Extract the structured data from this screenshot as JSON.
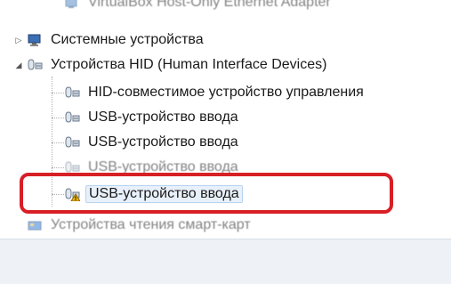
{
  "tree": {
    "items": [
      {
        "label": "VirtualBox Host-Only Ethernet Adapter",
        "icon": "network-adapter-icon",
        "state": "child"
      },
      {
        "label": "Системные устройства",
        "icon": "system-devices-icon",
        "state": "collapsed"
      },
      {
        "label": "Устройства HID (Human Interface Devices)",
        "icon": "hid-device-icon",
        "state": "expanded"
      },
      {
        "label": "HID-совместимое устройство управления",
        "icon": "hid-device-icon",
        "state": "child"
      },
      {
        "label": "USB-устройство ввода",
        "icon": "hid-device-icon",
        "state": "child"
      },
      {
        "label": "USB-устройство ввода",
        "icon": "hid-device-icon",
        "state": "child"
      },
      {
        "label": "USB-устройство ввода",
        "icon": "hid-device-icon",
        "state": "child"
      },
      {
        "label": "USB-устройство ввода",
        "icon": "hid-device-warning-icon",
        "state": "selected"
      },
      {
        "label": "Устройства чтения смарт-карт",
        "icon": "smart-card-reader-icon",
        "state": "collapsed"
      }
    ]
  },
  "colors": {
    "highlight_border": "#d81f26",
    "selection_bg": "#e8f1fb",
    "warning": "#f0b400"
  }
}
